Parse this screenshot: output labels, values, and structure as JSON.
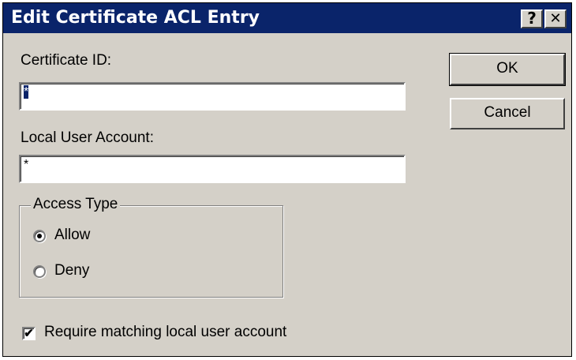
{
  "window": {
    "title": "Edit Certificate ACL Entry",
    "help_label": "?",
    "close_label": "✕"
  },
  "form": {
    "certificate_id_label": "Certificate ID:",
    "certificate_id_value": "*",
    "local_user_label": "Local User Account:",
    "local_user_value": "*"
  },
  "buttons": {
    "ok": "OK",
    "cancel": "Cancel"
  },
  "access_type": {
    "title": "Access Type",
    "options": [
      {
        "label": "Allow",
        "selected": true
      },
      {
        "label": "Deny",
        "selected": false
      }
    ]
  },
  "require_match": {
    "label": "Require matching local user account",
    "checked": true,
    "check_glyph": "✔"
  }
}
